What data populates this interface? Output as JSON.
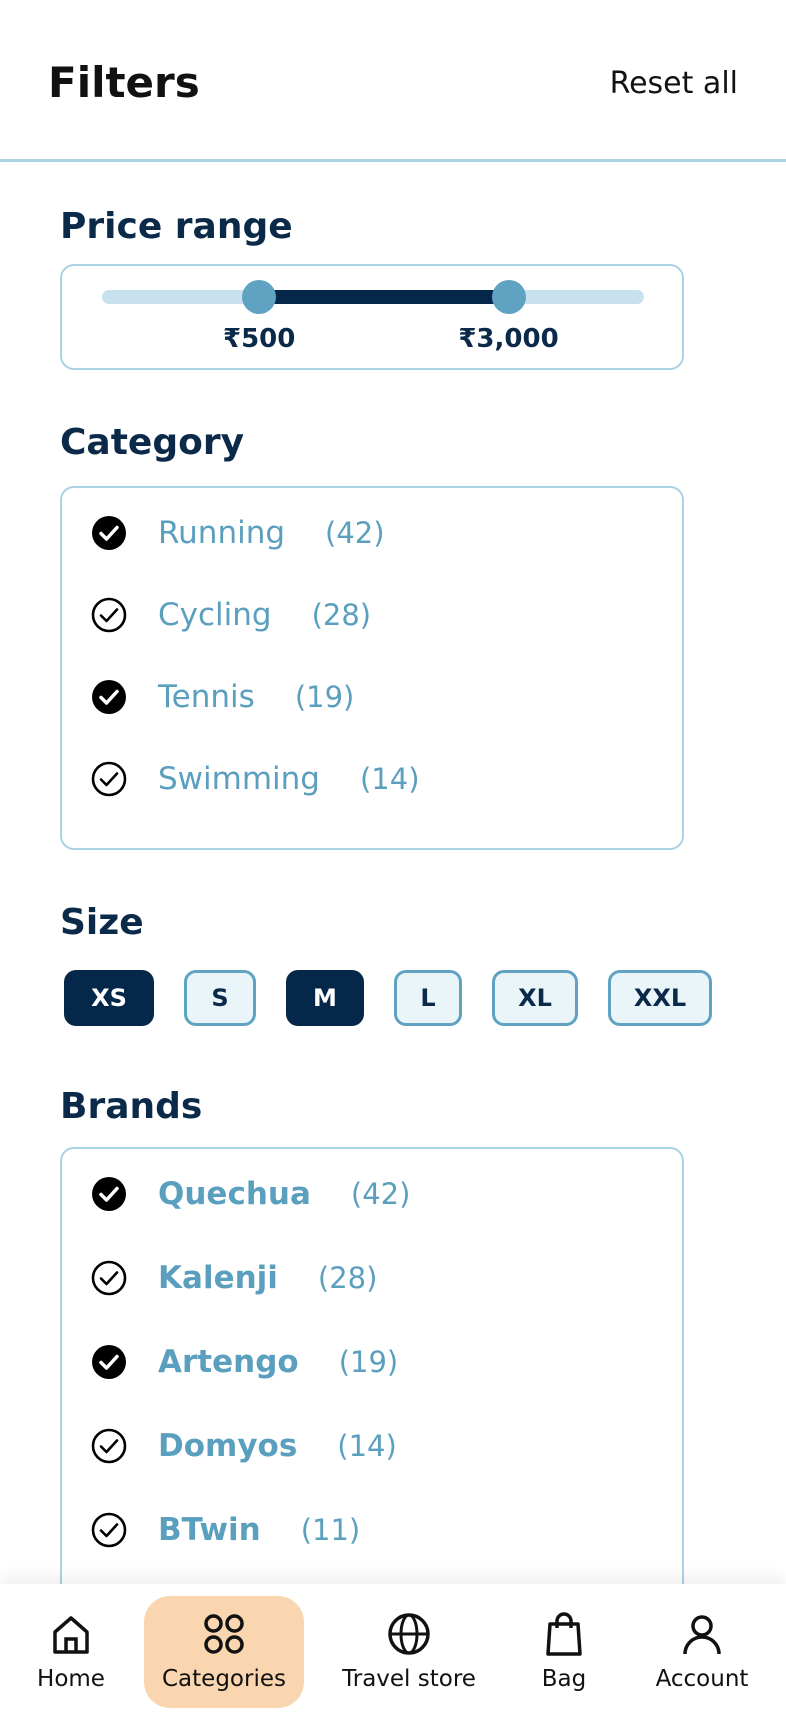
{
  "header": {
    "title": "Filters",
    "reset_label": "Reset all"
  },
  "price": {
    "title": "Price range",
    "min_label": "₹500",
    "max_label": "₹3,000",
    "low_fraction": 0.29,
    "high_fraction": 0.75
  },
  "category": {
    "title": "Category",
    "items": [
      {
        "label": "Running",
        "count": "(42)",
        "checked": true
      },
      {
        "label": "Cycling",
        "count": "(28)",
        "checked": false
      },
      {
        "label": "Tennis",
        "count": "(19)",
        "checked": true
      },
      {
        "label": "Swimming",
        "count": "(14)",
        "checked": false
      }
    ]
  },
  "size": {
    "title": "Size",
    "options": [
      {
        "label": "XS",
        "selected": true
      },
      {
        "label": "S",
        "selected": false
      },
      {
        "label": "M",
        "selected": true
      },
      {
        "label": "L",
        "selected": false
      },
      {
        "label": "XL",
        "selected": false
      },
      {
        "label": "XXL",
        "selected": false
      }
    ]
  },
  "brands": {
    "title": "Brands",
    "items": [
      {
        "label": "Quechua",
        "count": "(42)",
        "checked": true
      },
      {
        "label": "Kalenji",
        "count": "(28)",
        "checked": false
      },
      {
        "label": "Artengo",
        "count": "(19)",
        "checked": true
      },
      {
        "label": "Domyos",
        "count": "(14)",
        "checked": false
      },
      {
        "label": "BTwin",
        "count": "(11)",
        "checked": false
      }
    ]
  },
  "nav": {
    "items": [
      {
        "label": "Home",
        "icon": "home-icon",
        "active": false
      },
      {
        "label": "Categories",
        "icon": "categories-icon",
        "active": true
      },
      {
        "label": "Travel store",
        "icon": "globe-icon",
        "active": false
      },
      {
        "label": "Bag",
        "icon": "bag-icon",
        "active": false
      },
      {
        "label": "Account",
        "icon": "account-icon",
        "active": false
      }
    ]
  },
  "colors": {
    "navy": "#05284a",
    "accent": "#5fa2c2",
    "light": "#c7e2ee",
    "active_nav": "#fad6b0"
  }
}
